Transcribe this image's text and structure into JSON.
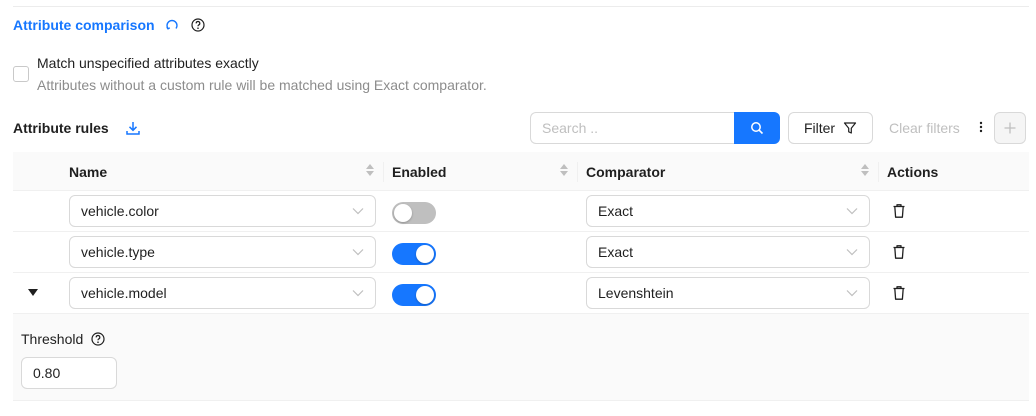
{
  "section": {
    "title": "Attribute comparison"
  },
  "match_unspecified": {
    "label": "Match unspecified attributes exactly",
    "description": "Attributes without a custom rule will be matched using Exact comparator.",
    "checked": false
  },
  "rules": {
    "title": "Attribute rules",
    "search_placeholder": "Search ..",
    "filter_label": "Filter",
    "clear_filters_label": "Clear filters"
  },
  "table": {
    "columns": [
      "Name",
      "Enabled",
      "Comparator",
      "Actions"
    ],
    "rows": [
      {
        "name": "vehicle.color",
        "enabled": false,
        "comparator": "Exact"
      },
      {
        "name": "vehicle.type",
        "enabled": true,
        "comparator": "Exact"
      },
      {
        "name": "vehicle.model",
        "enabled": true,
        "comparator": "Levenshtein"
      }
    ],
    "expanded": {
      "threshold_label": "Threshold",
      "threshold_value": "0.80"
    }
  },
  "colors": {
    "accent": "#1677ff",
    "toggle_off": "#bfbfbf"
  },
  "icons": [
    "refresh-icon",
    "help-icon",
    "download-icon",
    "search-icon",
    "filter-icon",
    "more-vertical-icon",
    "plus-icon",
    "sort-icon",
    "chevron-down-icon",
    "delete-icon",
    "expand-caret-icon"
  ]
}
